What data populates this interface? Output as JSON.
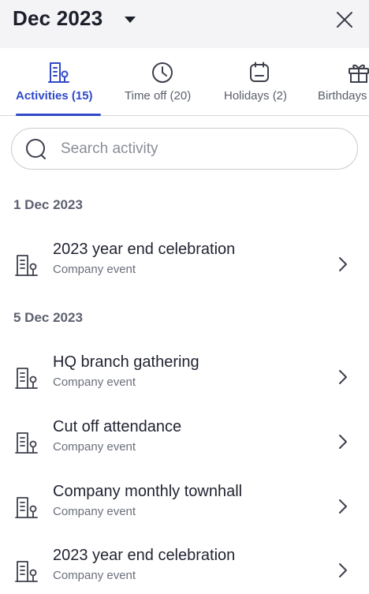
{
  "header": {
    "title": "Dec 2023",
    "caret_icon": "caret-down-icon",
    "close_icon": "close-icon"
  },
  "tabs": [
    {
      "label": "Activities (15)",
      "icon": "building-icon",
      "active": true
    },
    {
      "label": "Time off (20)",
      "icon": "clock-icon",
      "active": false
    },
    {
      "label": "Holidays (2)",
      "icon": "calendar-icon",
      "active": false
    },
    {
      "label": "Birthdays",
      "icon": "gift-icon",
      "active": false
    }
  ],
  "search": {
    "placeholder": "Search activity",
    "value": ""
  },
  "groups": [
    {
      "date": "1 Dec 2023",
      "items": [
        {
          "title": "2023 year end celebration",
          "subtitle": "Company event"
        }
      ]
    },
    {
      "date": "5 Dec 2023",
      "items": [
        {
          "title": "HQ branch gathering",
          "subtitle": "Company event"
        },
        {
          "title": "Cut off attendance",
          "subtitle": "Company event"
        },
        {
          "title": "Company monthly townhall",
          "subtitle": "Company event"
        },
        {
          "title": "2023 year end celebration",
          "subtitle": "Company event"
        }
      ]
    }
  ],
  "colors": {
    "accent": "#3049c8",
    "header_bg": "#f4f4f6",
    "muted_text": "#6b6f7c"
  }
}
